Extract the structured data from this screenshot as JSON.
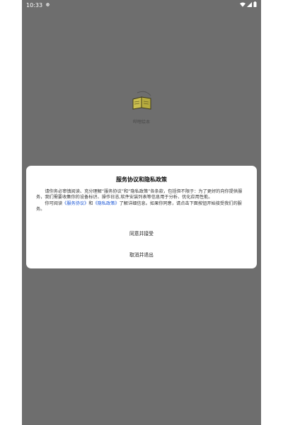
{
  "status_bar": {
    "time": "10:33",
    "notification_icon": "notification-dot-icon",
    "icons": [
      "wifi-icon",
      "signal-icon",
      "battery-icon"
    ]
  },
  "app": {
    "name": "哔哩绘本",
    "logo_icon": "book-logo-icon"
  },
  "dialog": {
    "title": "服务协议和隐私政策",
    "paragraph1": "请你务必审慎阅读、充分理解“服务协议”和“隐私政策”各条款，包括但不限于：为了更好的向你提供服务，我们需要收集你的设备标识、操作日志,软件安装列表等信息用于分析、优化应用性能。",
    "p2_prefix": "你可阅读",
    "link_service": "《服务协议》",
    "p2_and": "和",
    "link_privacy": "《隐私政策》",
    "p2_suffix": "了解详细信息。如果你同意，请点击下面按钮开始接受我们的服务。",
    "agree_label": "同意并接受",
    "cancel_label": "取消并退出"
  },
  "colors": {
    "overlay": "#6e6e6e",
    "dialog_bg": "#ffffff",
    "link": "#1a56d6"
  }
}
